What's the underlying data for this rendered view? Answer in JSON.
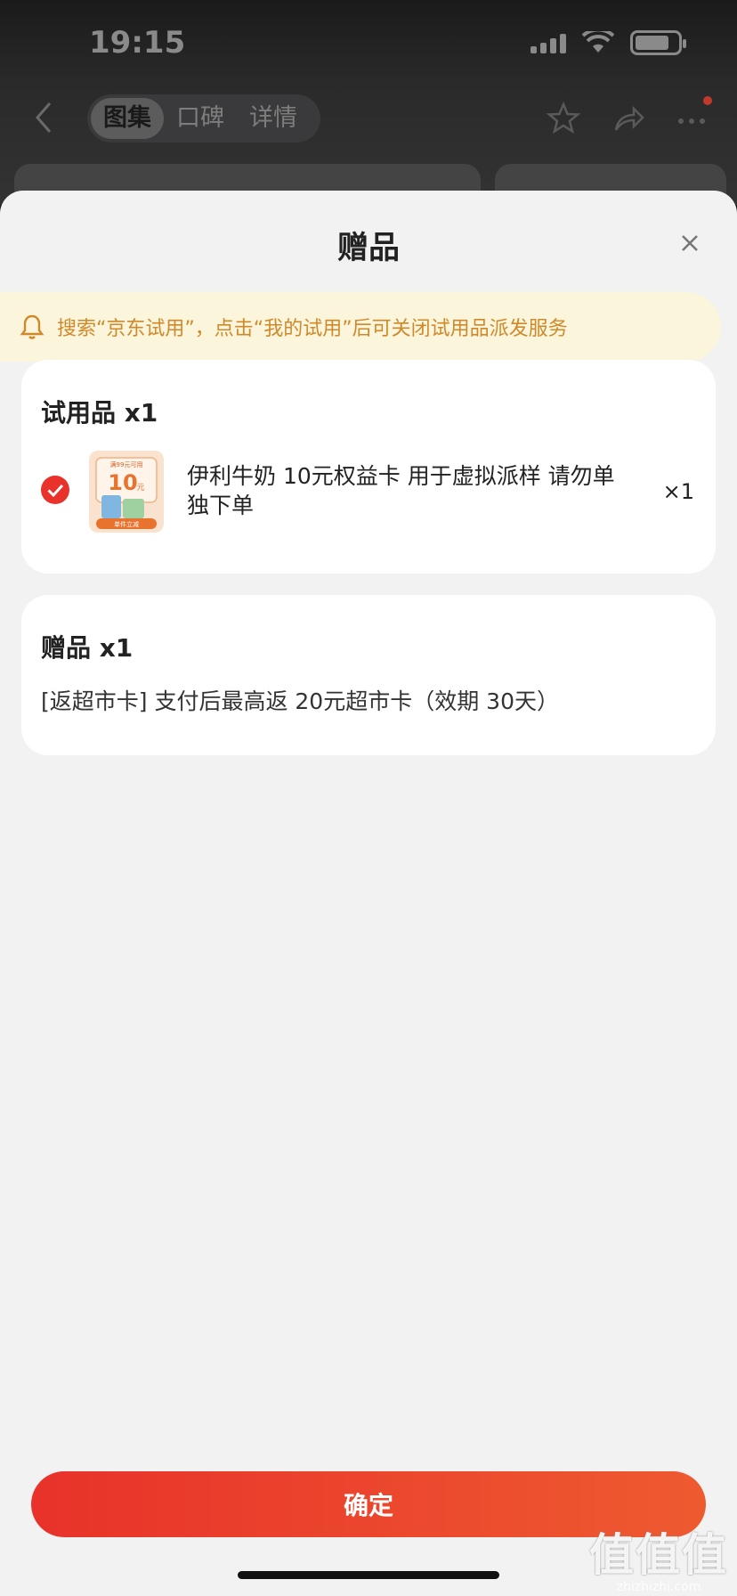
{
  "status_bar": {
    "time": "19:15"
  },
  "nav": {
    "tabs": [
      {
        "label": "图集",
        "active": true
      },
      {
        "label": "口碑",
        "active": false
      },
      {
        "label": "详情",
        "active": false
      }
    ]
  },
  "sheet": {
    "title": "赠品",
    "notice": "搜索“京东试用”，点击“我的试用”后可关闭试用品派发服务",
    "trial_section": {
      "title": "试用品 x1",
      "item": {
        "name": "伊利牛奶 10元权益卡 用于虚拟派样 请勿单独下单",
        "quantity": "×1",
        "checked": true,
        "thumbnail_text": {
          "top": "满99元可用",
          "amount": "10",
          "unit": "元",
          "bottom": "单件立减"
        }
      }
    },
    "gift_section": {
      "title": "赠品 x1",
      "description": "[返超市卡] 支付后最高返 20元超市卡（效期 30天）"
    },
    "confirm_label": "确定"
  },
  "watermark": {
    "logo": "值值值",
    "site": "zhizhizhi.com"
  },
  "colors": {
    "accent": "#e8322a",
    "notice_bg": "#fbf5dc",
    "notice_text": "#d0892a"
  }
}
